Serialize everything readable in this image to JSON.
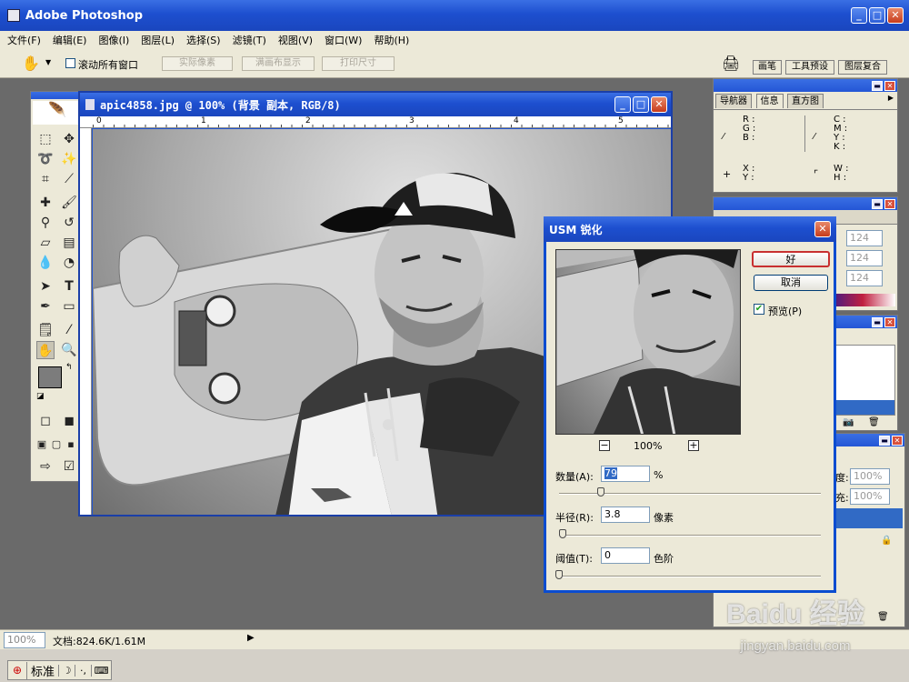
{
  "app": {
    "title": "Adobe Photoshop"
  },
  "menu": [
    "文件(F)",
    "编辑(E)",
    "图像(I)",
    "图层(L)",
    "选择(S)",
    "滤镜(T)",
    "视图(V)",
    "窗口(W)",
    "帮助(H)"
  ],
  "options": {
    "scroll_all": "滚动所有窗口",
    "actual_pixels": "实际像素",
    "fit_screen": "满画布显示",
    "print_size": "打印尺寸",
    "palette_tabs": [
      "画笔",
      "工具预设",
      "图层复合"
    ]
  },
  "document": {
    "title": "apic4858.jpg @ 100% (背景 副本, RGB/8)",
    "ruler_labels": [
      "0",
      "1",
      "2",
      "3",
      "4",
      "5"
    ]
  },
  "info_panel": {
    "tabs": [
      "导航器",
      "信息",
      "直方图"
    ],
    "rgb_labels": [
      "R :",
      "G :",
      "B :"
    ],
    "cmyk_labels": [
      "C :",
      "M :",
      "Y :",
      "K :"
    ],
    "xy_labels": [
      "X :",
      "Y :"
    ],
    "wh_labels": [
      "W :",
      "H :"
    ]
  },
  "color_panel": {
    "values": [
      "124",
      "124",
      "124"
    ]
  },
  "layers_panel": {
    "opacity": "100%",
    "fill": "100%",
    "opacity_prefix": "度:",
    "fill_prefix": "充:"
  },
  "usm_dialog": {
    "title": "USM 锐化",
    "ok_label": "好",
    "cancel_label": "取消",
    "preview_label": "预览(P)",
    "zoom": "100%",
    "amount_label": "数量(A):",
    "amount_value": "79",
    "amount_unit": "%",
    "amount_level": 0.16,
    "radius_label": "半径(R):",
    "radius_value": "3.8",
    "radius_unit": "像素",
    "radius_level": 0.013,
    "threshold_label": "阈值(T):",
    "threshold_value": "0",
    "threshold_unit": "色阶",
    "threshold_level": 0.0
  },
  "status": {
    "zoom": "100%",
    "doc_size": "文档:824.6K/1.61M"
  },
  "taskbar": {
    "ime_label": "标准"
  },
  "watermark": {
    "brand": "Baidu 经验",
    "url": "jingyan.baidu.com"
  }
}
